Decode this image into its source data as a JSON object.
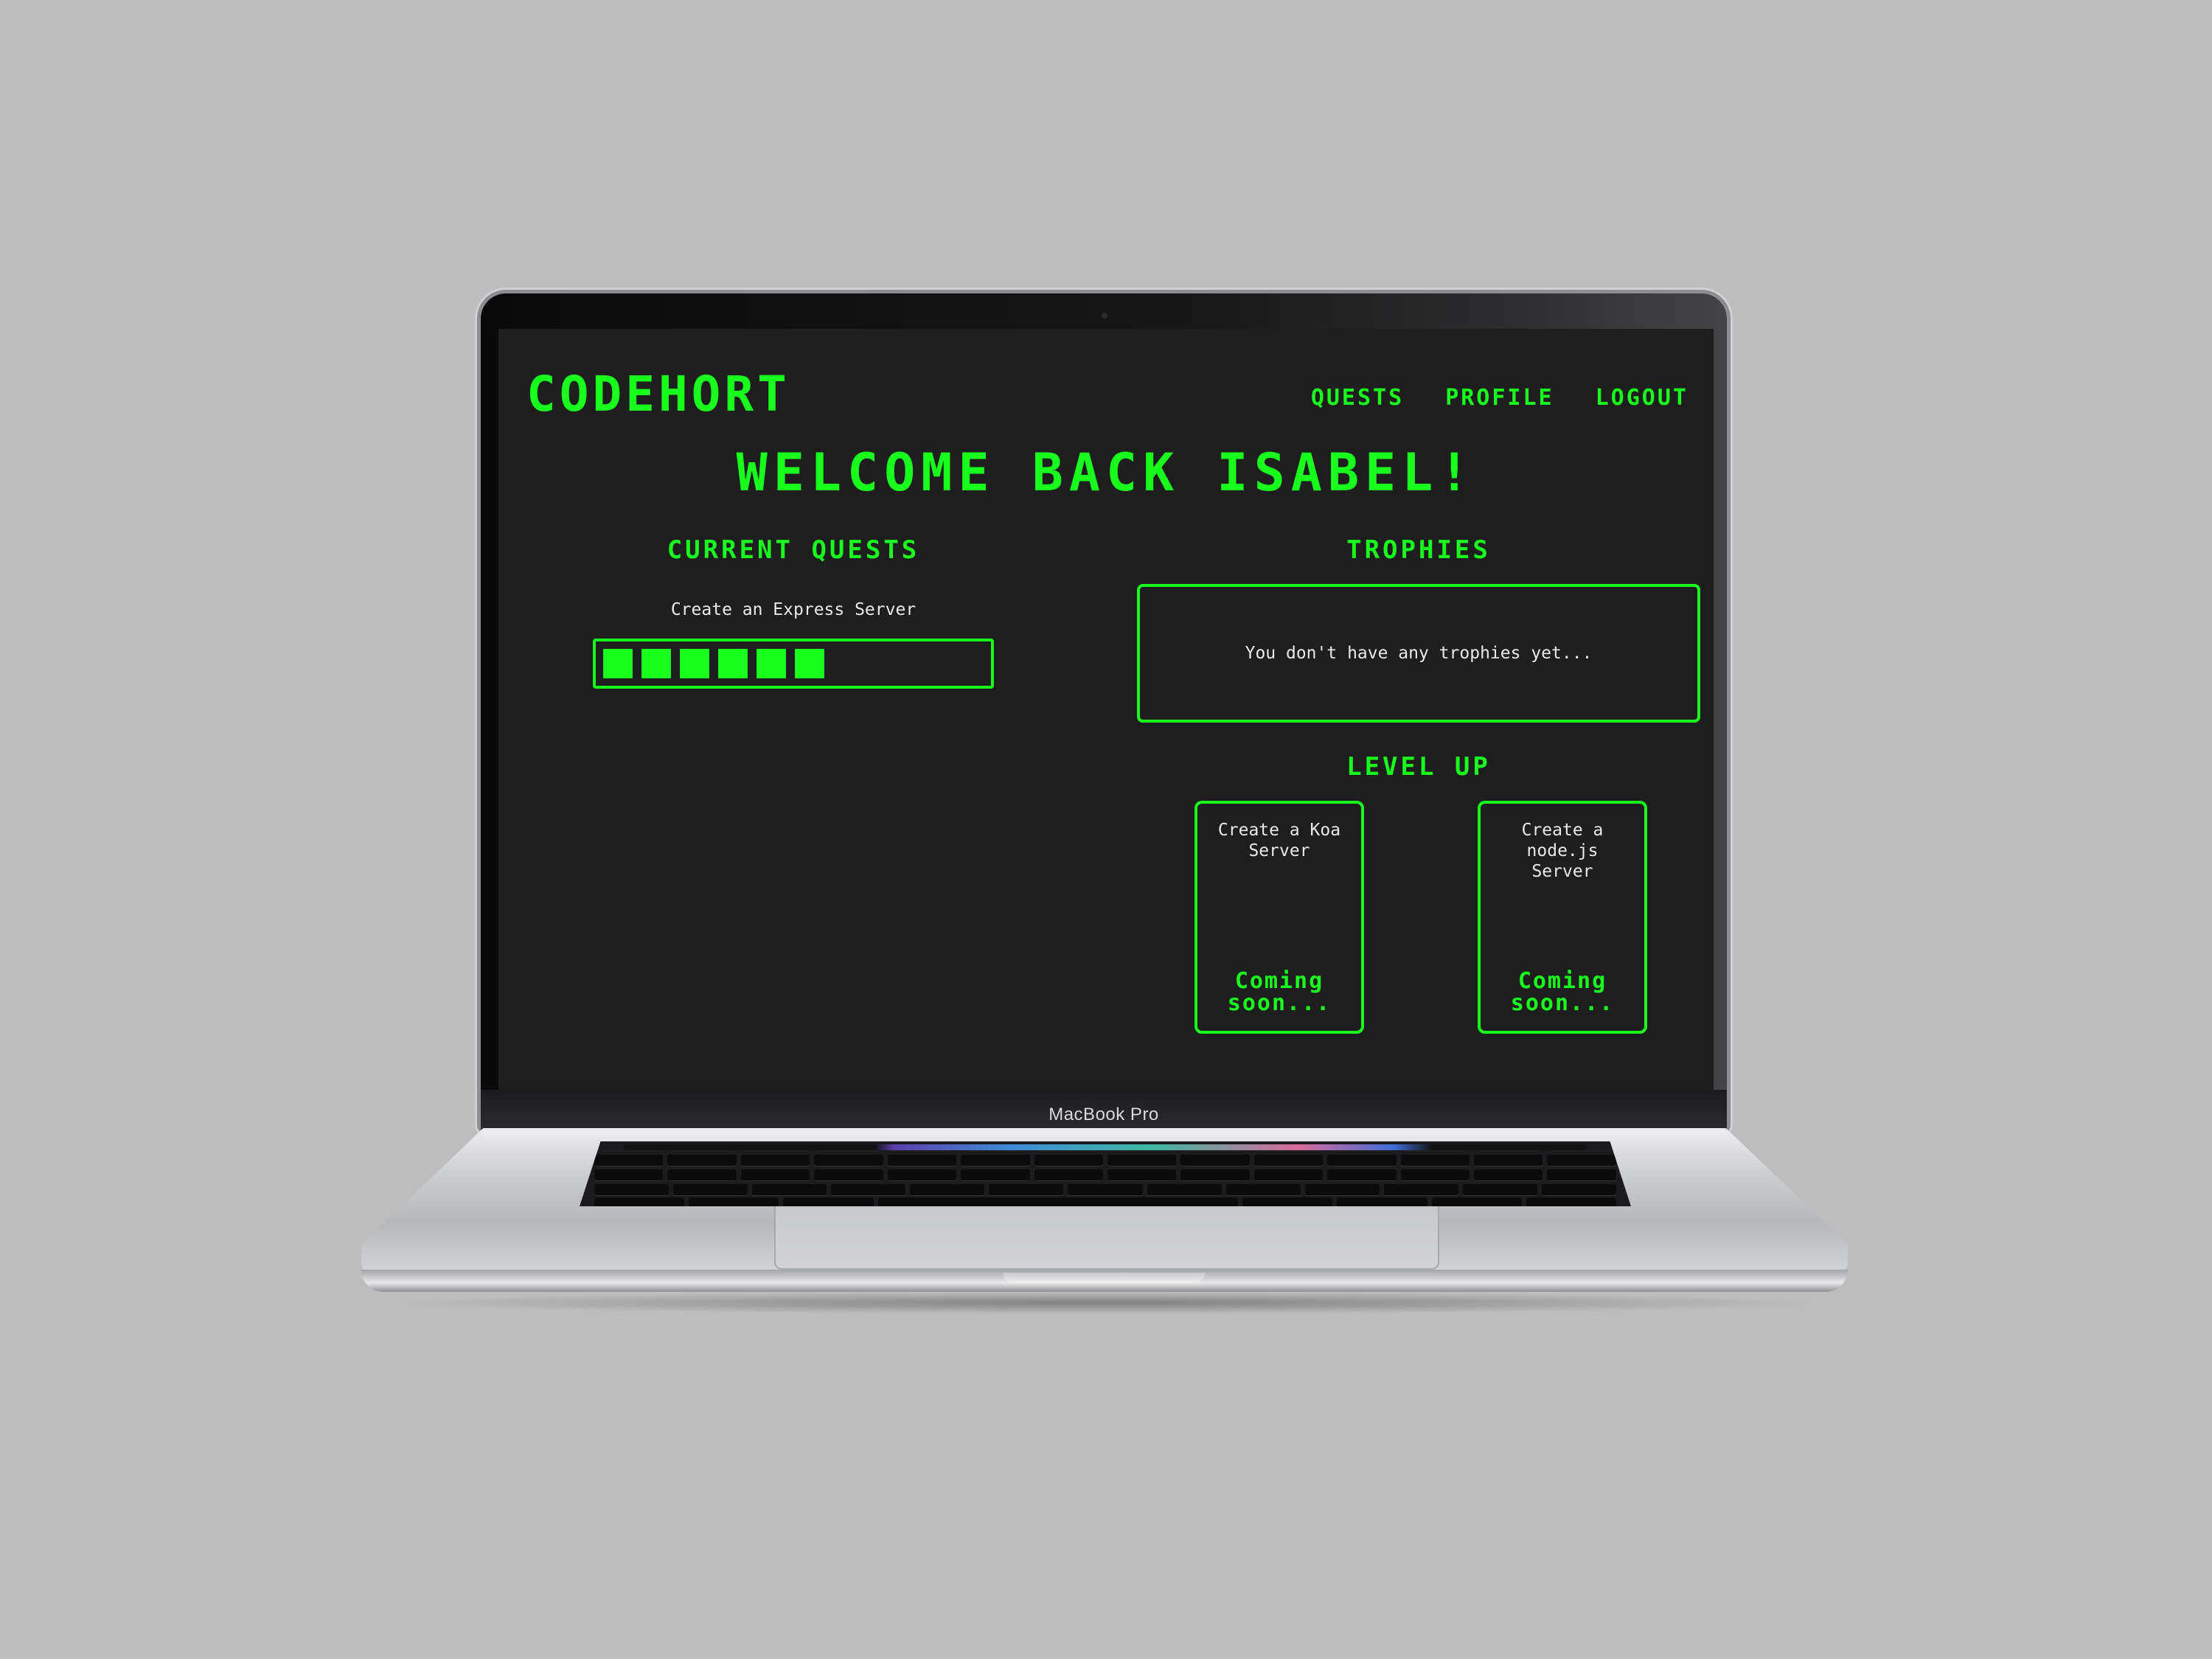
{
  "device": {
    "brand_label": "MacBook Pro"
  },
  "app": {
    "logo": "CODEHORT",
    "nav": [
      "QUESTS",
      "PROFILE",
      "LOGOUT"
    ],
    "welcome": "WELCOME BACK ISABEL!",
    "current_quests": {
      "title": "CURRENT QUESTS",
      "items": [
        {
          "name": "Create an Express Server",
          "progress_segments": 6
        }
      ]
    },
    "trophies": {
      "title": "TROPHIES",
      "empty_message": "You don't have any trophies yet..."
    },
    "level_up": {
      "title": "LEVEL UP",
      "cards": [
        {
          "title": "Create a Koa Server",
          "status": "Coming soon..."
        },
        {
          "title": "Create a node.js Server",
          "status": "Coming soon..."
        }
      ]
    }
  },
  "colors": {
    "accent": "#19ff1d",
    "background": "#1e1e1e",
    "text": "#e9e9e9"
  }
}
